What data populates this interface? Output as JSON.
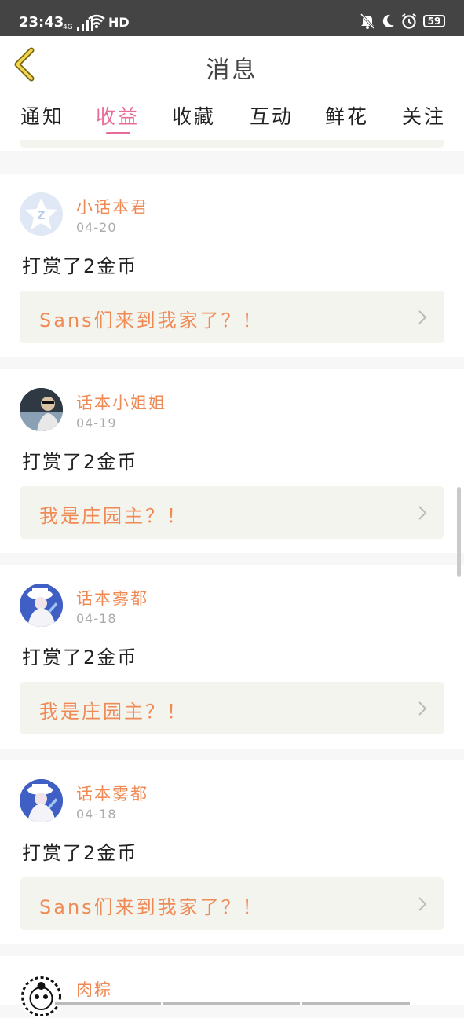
{
  "status_bar": {
    "time": "23:43",
    "network": "4G",
    "hd": "HD",
    "battery": "59"
  },
  "header": {
    "title": "消息"
  },
  "tabs": [
    {
      "label": "通知",
      "active": false
    },
    {
      "label": "收益",
      "active": true
    },
    {
      "label": "收藏",
      "active": false
    },
    {
      "label": "互动",
      "active": false
    },
    {
      "label": "鲜花",
      "active": false
    },
    {
      "label": "关注",
      "active": false
    }
  ],
  "messages": [
    {
      "username": "小话本君",
      "date": "04-20",
      "action": "打赏了2金币",
      "story": "Sans们来到我家了？！",
      "avatar": "star-logo-avatar"
    },
    {
      "username": "话本小姐姐",
      "date": "04-19",
      "action": "打赏了2金币",
      "story": "我是庄园主？！",
      "avatar": "photo-avatar"
    },
    {
      "username": "话本雾都",
      "date": "04-18",
      "action": "打赏了2金币",
      "story": "我是庄园主？！",
      "avatar": "anime-avatar"
    },
    {
      "username": "话本雾都",
      "date": "04-18",
      "action": "打赏了2金币",
      "story": "Sans们来到我家了？！",
      "avatar": "anime-avatar"
    },
    {
      "username": "肉粽",
      "date": "",
      "action": "",
      "story": "",
      "avatar": "panda-avatar"
    }
  ],
  "colors": {
    "accent": "#e86c9a",
    "username": "#f08a55",
    "card_bg": "#f4f4ee",
    "page_bg": "#f7f7f7",
    "status_bg": "#444444"
  }
}
